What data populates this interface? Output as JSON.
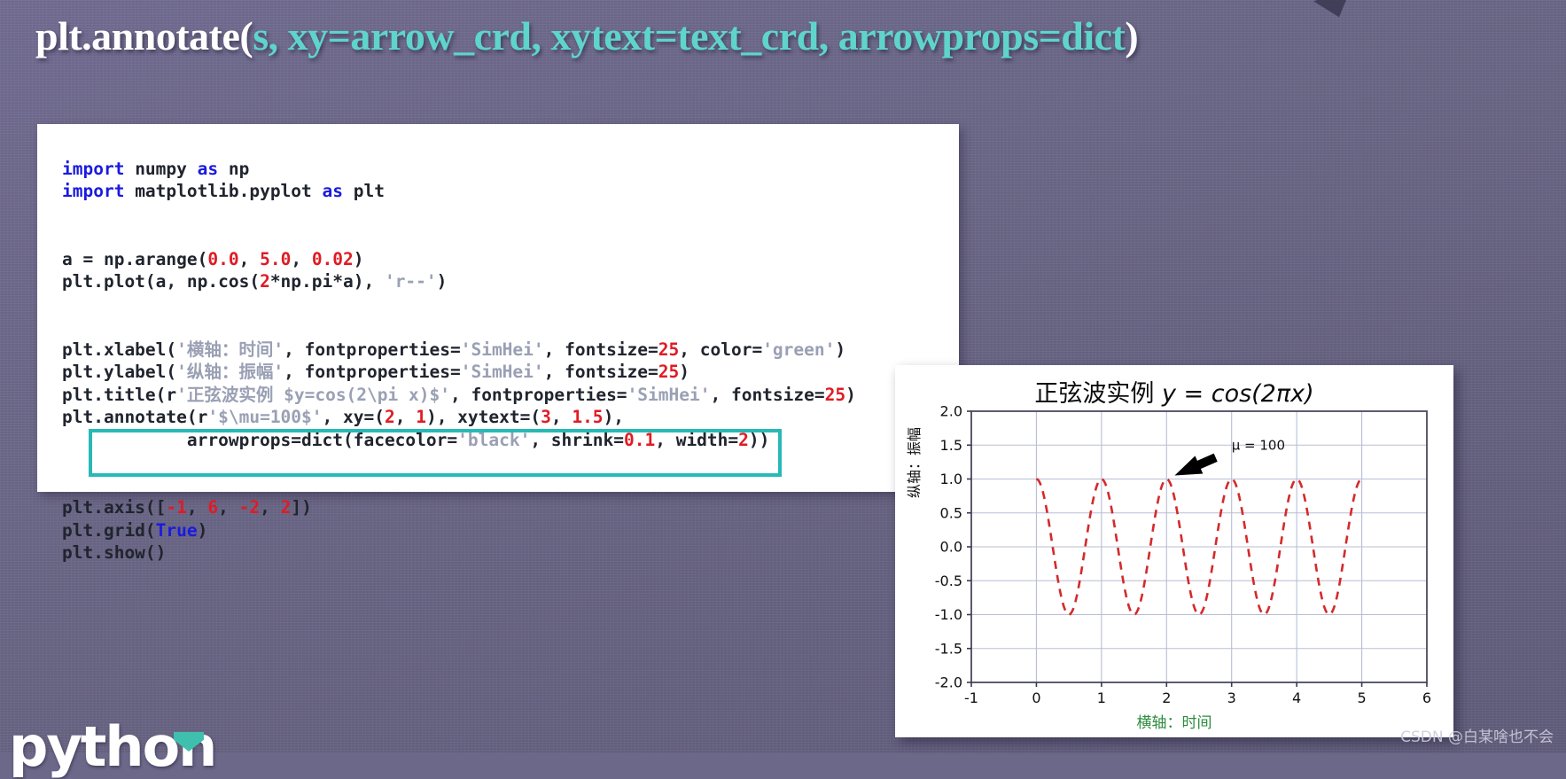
{
  "slide": {
    "background_color": "#6c6889",
    "title": {
      "part_white_1": "plt.annotate(",
      "part_teal_1": "s, xy=arrow_crd, xytext=text_crd, arrowprops=dict",
      "part_white_2": ")"
    }
  },
  "code": {
    "lines": [
      "import numpy as np",
      "import matplotlib.pyplot as plt",
      "",
      "a = np.arange(0.0, 5.0, 0.02)",
      "plt.plot(a, np.cos(2*np.pi*a), 'r--')",
      "",
      "plt.xlabel('横轴：时间', fontproperties='SimHei', fontsize=25, color='green')",
      "plt.ylabel('纵轴：振幅', fontproperties='SimHei', fontsize=25)",
      "plt.title(r'正弦波实例 $y=cos(2\\pi x)$', fontproperties='SimHei', fontsize=25)",
      "plt.annotate(r'$\\mu=100$', xy=(2, 1), xytext=(3, 1.5),",
      "            arrowprops=dict(facecolor='black', shrink=0.1, width=2))",
      "",
      "plt.axis([-1, 6, -2, 2])",
      "plt.grid(True)",
      "plt.show()"
    ],
    "highlight_box_color": "#27b9b5",
    "keyword_color": "#1a1ae0",
    "number_color": "#e01b24",
    "string_color": "#9aa0b4"
  },
  "chart_data": {
    "type": "line",
    "title": "正弦波实例  y = cos(2πx)",
    "title_chinese": "正弦波实例",
    "title_math": "y = cos(2πx)",
    "xlabel": "横轴：时间",
    "ylabel": "纵轴：振幅",
    "xlabel_color": "#2e8b3f",
    "xlim": [
      -1,
      6
    ],
    "ylim": [
      -2,
      2
    ],
    "xticks": [
      "-1",
      "0",
      "1",
      "2",
      "3",
      "4",
      "5",
      "6"
    ],
    "yticks": [
      "2.0",
      "1.5",
      "1.0",
      "0.5",
      "0.0",
      "-0.5",
      "-1.0",
      "-1.5",
      "-2.0"
    ],
    "grid": true,
    "legend": "none",
    "series": [
      {
        "name": "cos(2πx)",
        "style": "r--",
        "color": "#d42a2a",
        "linestyle": "dashed",
        "x_start": 0.0,
        "x_end": 5.0,
        "x_step": 0.02,
        "formula": "y = cos(2*pi*x)",
        "amplitude": 1.0,
        "period": 1.0,
        "y_max": 1.0,
        "y_min": -1.0,
        "peaks_x": [
          0,
          1,
          2,
          3,
          4,
          5
        ],
        "troughs_x": [
          0.5,
          1.5,
          2.5,
          3.5,
          4.5
        ]
      }
    ],
    "annotation": {
      "text": "μ = 100",
      "xy": [
        2,
        1
      ],
      "xytext": [
        3,
        1.5
      ],
      "arrow_color": "#000000"
    }
  },
  "footer": {
    "python_logo_text": "python",
    "watermark": "CSDN @白某啥也不会"
  }
}
